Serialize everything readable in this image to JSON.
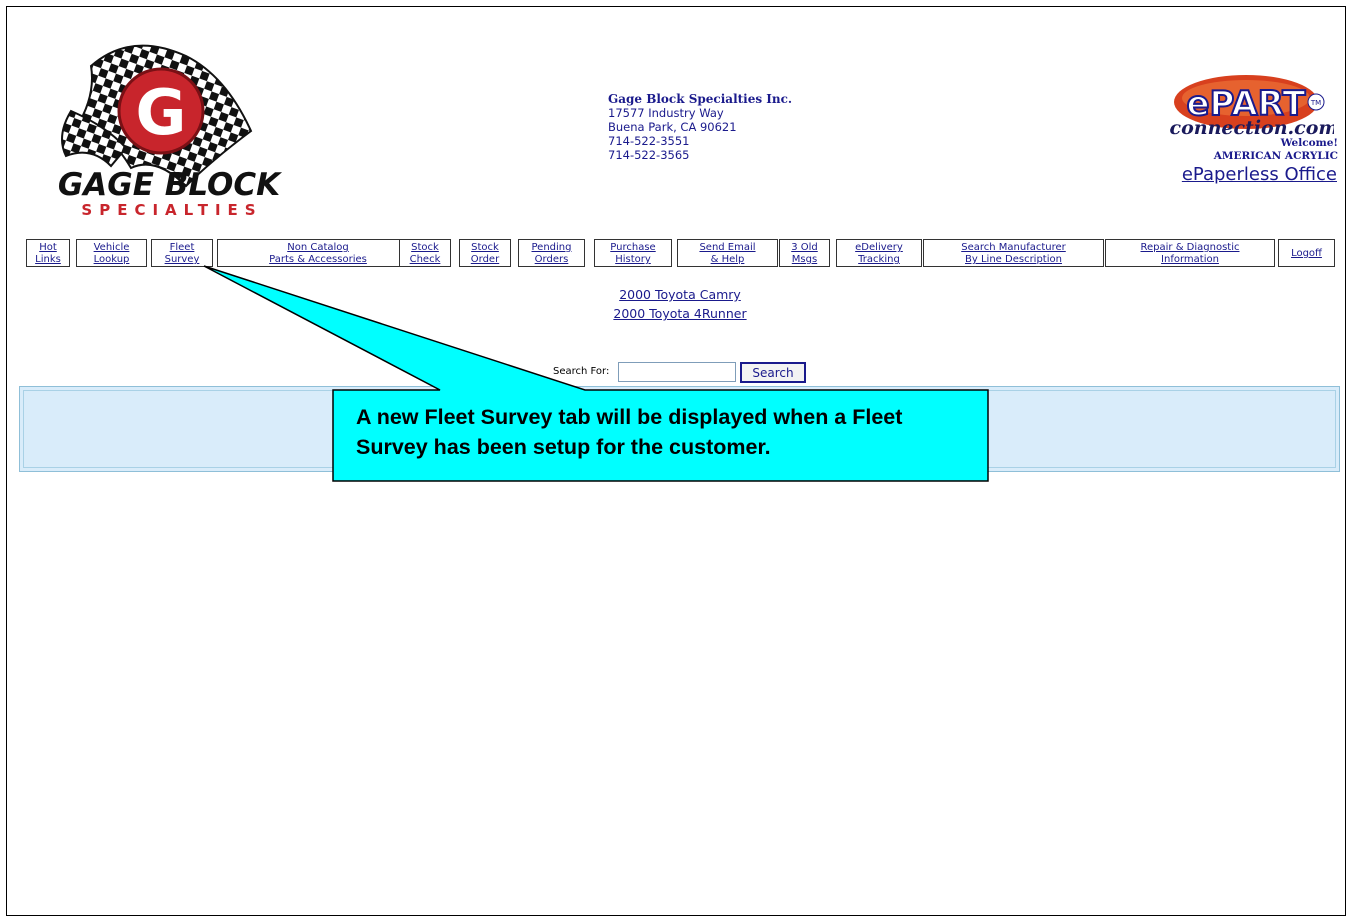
{
  "company": {
    "name": "Gage Block Specialties Inc.",
    "address1": "17577 Industry Way",
    "address2": "Buena Park, CA 90621",
    "phone1": "714-522-3551",
    "phone2": "714-522-3565"
  },
  "logo": {
    "word": "GAGE BLOCK",
    "sub": "SPECIALTIES",
    "letter": "G"
  },
  "epart": {
    "brand": "ePART",
    "tm": "TM",
    "domain": "connection.com"
  },
  "user": {
    "welcome": "Welcome!",
    "customer": "AMERICAN ACRYLIC",
    "office_link": "ePaperless Office"
  },
  "nav": [
    {
      "line1": "Hot",
      "line2": "Links"
    },
    {
      "line1": "Vehicle",
      "line2": "Lookup"
    },
    {
      "line1": "Fleet",
      "line2": "Survey"
    },
    {
      "line1": "Non Catalog",
      "line2": "Parts & Accessories"
    },
    {
      "line1": "Stock",
      "line2": "Check"
    },
    {
      "line1": "Stock",
      "line2": "Order"
    },
    {
      "line1": "Pending",
      "line2": "Orders"
    },
    {
      "line1": "Purchase",
      "line2": "History"
    },
    {
      "line1": "Send Email",
      "line2": "& Help"
    },
    {
      "line1": "3 Old",
      "line2": "Msgs"
    },
    {
      "line1": "eDelivery",
      "line2": "Tracking"
    },
    {
      "line1": "Search Manufacturer",
      "line2": "By Line Description"
    },
    {
      "line1": "Repair & Diagnostic",
      "line2": "Information"
    },
    {
      "line1": "Logoff"
    }
  ],
  "vehicles": [
    "2000 Toyota Camry",
    "2000 Toyota 4Runner"
  ],
  "search": {
    "label": "Search For:",
    "value": "",
    "button": "Search"
  },
  "callout": {
    "text": "A new Fleet Survey tab will be displayed when a Fleet Survey has been setup for the customer."
  },
  "colors": {
    "link": "#1a1a8c",
    "callout_fill": "#00ffff",
    "panel": "#d9ecfa",
    "logo_red": "#c8252c"
  }
}
